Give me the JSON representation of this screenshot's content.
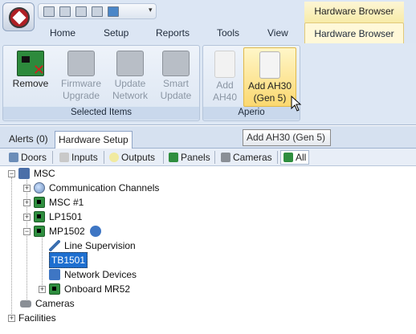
{
  "quick_access": {
    "icons": [
      "save-icon",
      "save-all-icon",
      "print-icon",
      "print-preview-icon",
      "monitor-icon"
    ],
    "dropdown_glyph": "▾"
  },
  "contextual_group": {
    "title": "Hardware Browser"
  },
  "tabs": [
    {
      "label": "Home"
    },
    {
      "label": "Setup"
    },
    {
      "label": "Reports"
    },
    {
      "label": "Tools"
    },
    {
      "label": "View"
    },
    {
      "label": "Hardware Browser",
      "active": true
    }
  ],
  "ribbon": {
    "groups": [
      {
        "label": "Selected Items",
        "buttons": [
          {
            "line1": "Remove",
            "line2": "",
            "enabled": true
          },
          {
            "line1": "Firmware",
            "line2": "Upgrade",
            "enabled": false
          },
          {
            "line1": "Update",
            "line2": "Network",
            "enabled": false
          },
          {
            "line1": "Smart",
            "line2": "Update",
            "enabled": false
          }
        ]
      },
      {
        "label": "Aperio",
        "buttons": [
          {
            "line1": "Add",
            "line2": "AH40",
            "enabled": false
          },
          {
            "line1": "Add AH30",
            "line2": "(Gen 5)",
            "enabled": true,
            "hovered": true
          }
        ]
      }
    ]
  },
  "tooltip": {
    "text": "Add AH30 (Gen 5)"
  },
  "panel_tabs": [
    {
      "label": "Alerts (0)"
    },
    {
      "label": "Hardware Setup",
      "active": true
    }
  ],
  "filter_bar": [
    {
      "label": "Doors",
      "icon": "door-icon"
    },
    {
      "label": "Inputs",
      "icon": "input-icon"
    },
    {
      "label": "Outputs",
      "icon": "bulb-icon"
    },
    {
      "label": "Panels",
      "icon": "panel-icon"
    },
    {
      "label": "Cameras",
      "icon": "camera-icon"
    },
    {
      "label": "All",
      "icon": "all-icon",
      "active": true
    }
  ],
  "tree": {
    "root": "MSC",
    "communication_channels": "Communication Channels",
    "msc1": "MSC #1",
    "lp1501": "LP1501",
    "mp1502": "MP1502",
    "line_supervision": "Line Supervision",
    "tb1501": "TB1501",
    "network_devices": "Network Devices",
    "onboard_mr52": "Onboard MR52",
    "cameras": "Cameras",
    "facilities": "Facilities"
  },
  "colors": {
    "ribbon_bg": "#dde7f4",
    "hover_gold": "#fbd870",
    "selection_blue": "#1e6fd0"
  }
}
